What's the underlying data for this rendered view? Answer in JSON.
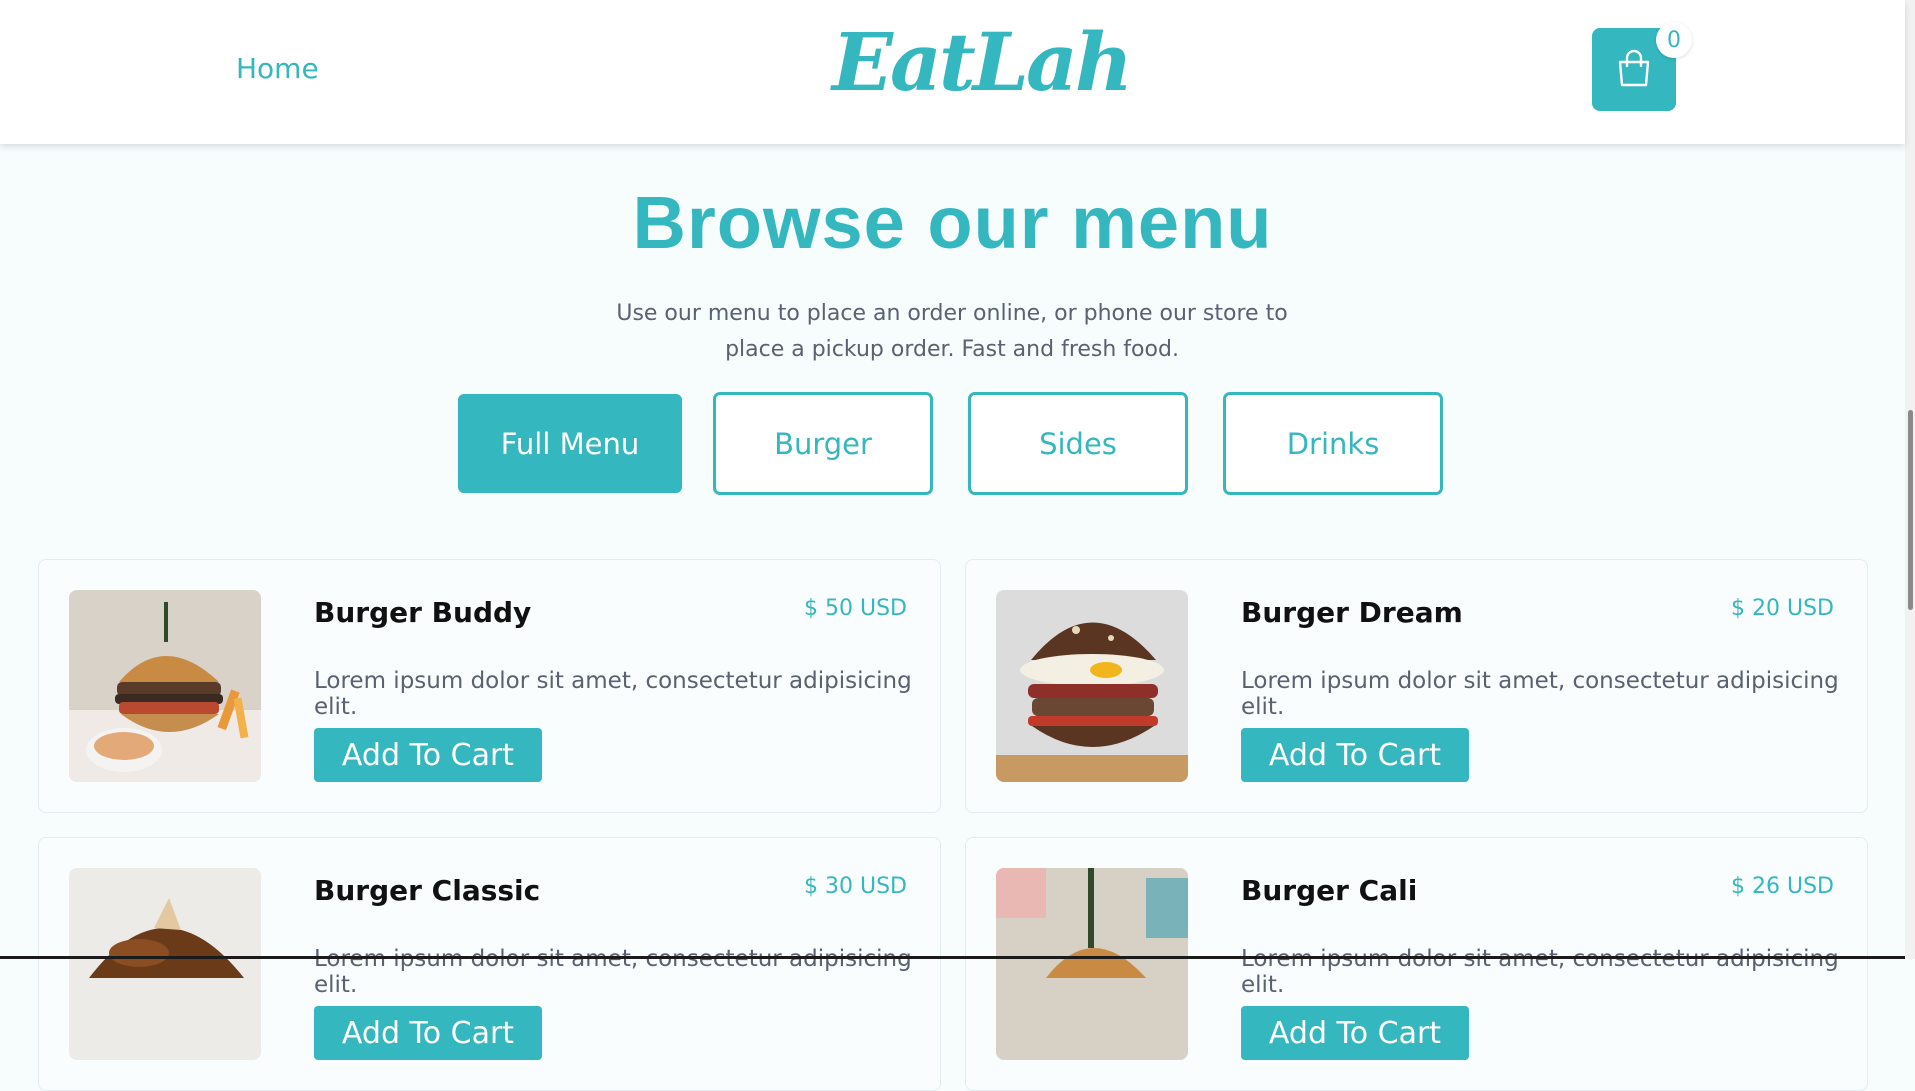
{
  "nav": {
    "home": "Home"
  },
  "brand": {
    "logo": "EatLah"
  },
  "cart": {
    "count": "0"
  },
  "hero": {
    "title": "Browse our menu",
    "subtitle": "Use our menu to place an order online, or phone our store to place a pickup order. Fast and fresh food."
  },
  "filters": [
    {
      "label": "Full Menu",
      "active": true
    },
    {
      "label": "Burger",
      "active": false
    },
    {
      "label": "Sides",
      "active": false
    },
    {
      "label": "Drinks",
      "active": false
    }
  ],
  "products": [
    {
      "name": "Burger Buddy",
      "price": "$ 50 USD",
      "desc": "Lorem ipsum dolor sit amet, consectetur adipisicing elit.",
      "button": "Add To Cart",
      "image": "burger-fries-photo"
    },
    {
      "name": "Burger Dream",
      "price": "$ 20 USD",
      "desc": "Lorem ipsum dolor sit amet, consectetur adipisicing elit.",
      "button": "Add To Cart",
      "image": "burger-egg-photo"
    },
    {
      "name": "Burger Classic",
      "price": "$ 30 USD",
      "desc": "Lorem ipsum dolor sit amet, consectetur adipisicing elit.",
      "button": "Add To Cart",
      "image": "burger-pretzel-photo"
    },
    {
      "name": "Burger Cali",
      "price": "$ 26 USD",
      "desc": "Lorem ipsum dolor sit amet, consectetur adipisicing elit.",
      "button": "Add To Cart",
      "image": "burger-skewer-photo"
    }
  ],
  "colors": {
    "accent": "#35b7bf",
    "page_bg": "#f7fcfd",
    "text_muted": "#5a6170"
  }
}
